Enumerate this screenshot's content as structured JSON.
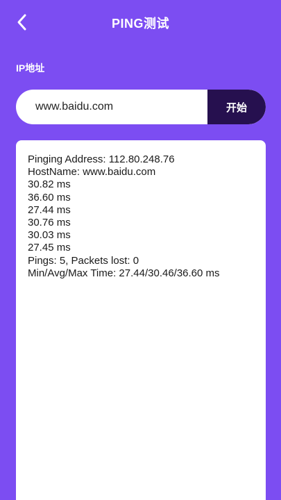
{
  "header": {
    "title": "PING测试",
    "back_icon": "chevron-left-icon"
  },
  "form": {
    "ip_label": "IP地址",
    "ip_value": "www.baidu.com",
    "start_label": "开始"
  },
  "result": {
    "lines": [
      "Pinging Address: 112.80.248.76",
      "HostName: www.baidu.com",
      "30.82 ms",
      "36.60 ms",
      "27.44 ms",
      "30.76 ms",
      "30.03 ms",
      "27.45 ms",
      "Pings: 5, Packets lost: 0",
      "Min/Avg/Max Time: 27.44/30.46/36.60 ms"
    ]
  },
  "colors": {
    "background": "#7c4df2",
    "button": "#26104f",
    "panel": "#ffffff"
  }
}
